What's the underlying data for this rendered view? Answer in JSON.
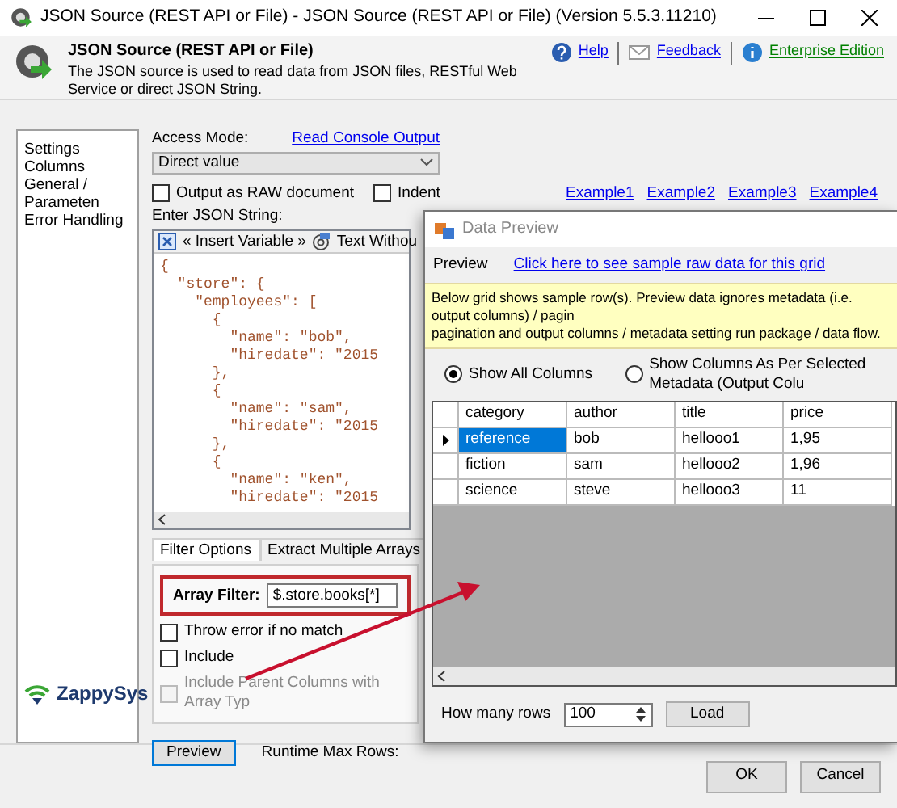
{
  "window": {
    "title": "JSON Source (REST API or File) - JSON Source (REST API or File) (Version 5.5.3.11210)"
  },
  "header": {
    "title": "JSON Source (REST API or File)",
    "description": "The JSON source is used to read data from JSON files, RESTful Web Service or direct JSON String.",
    "links": [
      {
        "kind": "help",
        "label": "Help"
      },
      {
        "kind": "feedback",
        "label": "Feedback"
      },
      {
        "kind": "edition",
        "label": "Enterprise Edition"
      }
    ]
  },
  "sidebar": {
    "items": [
      "Settings",
      "Columns",
      "General / Parameten",
      "Error Handling"
    ],
    "logo": "ZappySys"
  },
  "settings": {
    "access_mode_label": "Access Mode:",
    "console_link": "Read Console Output",
    "access_mode_value": "Direct value",
    "options": [
      {
        "label": "Output as RAW document",
        "checked": false
      },
      {
        "label": "Indent",
        "checked": false
      }
    ],
    "examples": [
      "Example1",
      "Example2",
      "Example3",
      "Example4"
    ],
    "json_label": "Enter JSON String:",
    "toolbar": [
      {
        "kind": "variable",
        "label": "« Insert Variable »"
      },
      {
        "kind": "text",
        "label": "Text Withou"
      }
    ],
    "json_lines": [
      "{",
      "  \"store\": {",
      "    \"employees\": [",
      "      {",
      "        \"name\": \"bob\",",
      "        \"hiredate\": \"2015",
      "      },",
      "      {",
      "        \"name\": \"sam\",",
      "        \"hiredate\": \"2015",
      "      },",
      "      {",
      "        \"name\": \"ken\",",
      "        \"hiredate\": \"2015"
    ]
  },
  "filter": {
    "tabs": [
      {
        "label": "Filter Options",
        "selected": true
      },
      {
        "label": "Extract Multiple Arrays",
        "selected": false
      }
    ],
    "array_filter_label": "Array Filter:",
    "array_filter_value": "$.store.books[*]",
    "checks": [
      {
        "label": "Throw error if no match",
        "checked": false,
        "disabled": false
      },
      {
        "label": "Include",
        "checked": false,
        "disabled": false
      },
      {
        "label": "Include Parent Columns with Array Typ",
        "checked": false,
        "disabled": true
      }
    ]
  },
  "preview_button": "Preview",
  "runtime_label": "Runtime Max Rows:",
  "buttons": [
    "OK",
    "Cancel"
  ],
  "preview_window": {
    "title": "Data Preview",
    "preview_label": "Preview",
    "raw_link": "Click here to see sample raw data for this grid",
    "note_lines": [
      "Below grid shows sample row(s). Preview data ignores metadata (i.e. output columns) / pagin",
      "pagination and output columns / metadata setting run package / data flow."
    ],
    "column_modes": [
      {
        "label": "Show All Columns",
        "selected": true
      },
      {
        "label": "Show Columns As Per Selected Metadata (Output Colu",
        "selected": false
      }
    ],
    "columns": [
      "category",
      "author",
      "title",
      "price"
    ],
    "rows": [
      {
        "current": true,
        "cells": [
          {
            "text": "reference",
            "selected": true
          },
          {
            "text": "bob",
            "selected": false
          },
          {
            "text": "hellooo1",
            "selected": false
          },
          {
            "text": "1,95",
            "selected": false
          }
        ]
      },
      {
        "current": false,
        "cells": [
          {
            "text": "fiction",
            "selected": false
          },
          {
            "text": "sam",
            "selected": false
          },
          {
            "text": "hellooo2",
            "selected": false
          },
          {
            "text": "1,96",
            "selected": false
          }
        ]
      },
      {
        "current": false,
        "cells": [
          {
            "text": "science",
            "selected": false
          },
          {
            "text": "steve",
            "selected": false
          },
          {
            "text": "hellooo3",
            "selected": false
          },
          {
            "text": "11",
            "selected": false
          }
        ]
      }
    ],
    "rows_label": "How many rows",
    "rows_value": "100",
    "load_button": "Load"
  }
}
